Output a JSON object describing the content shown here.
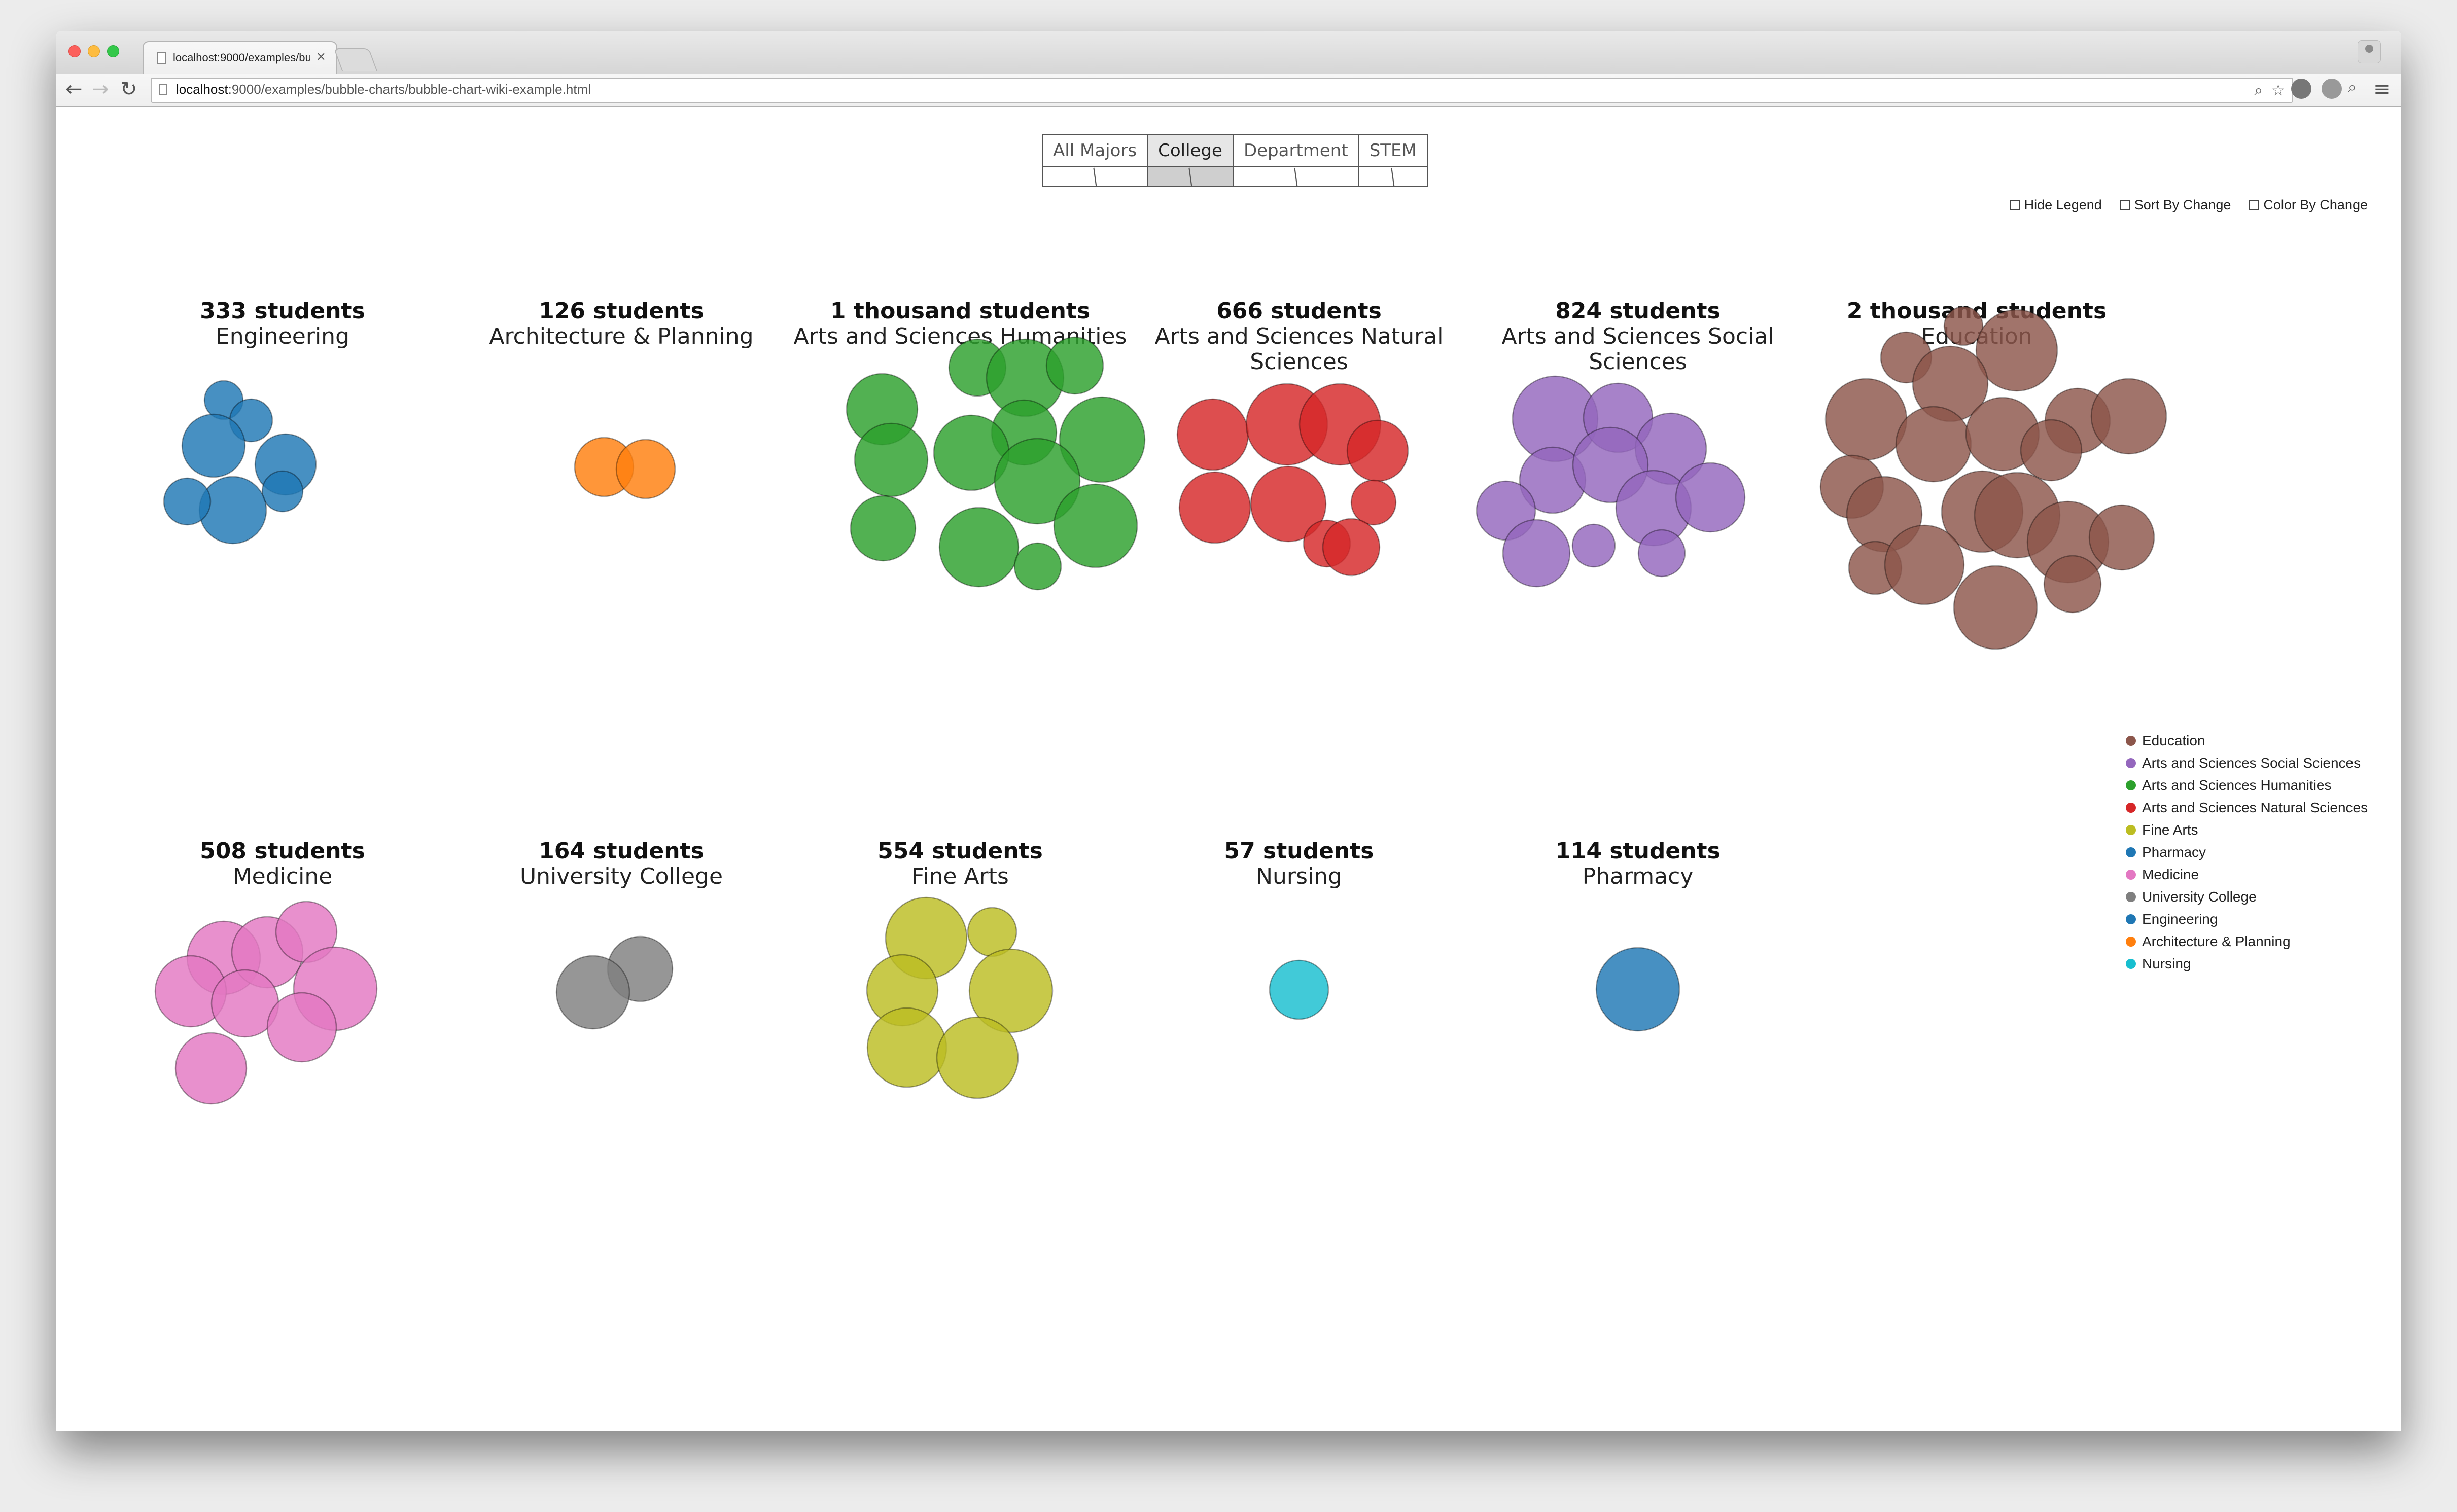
{
  "browser": {
    "tab_title": "localhost:9000/examples/bu",
    "tab_close": "×",
    "url_host": "localhost",
    "url_rest": ":9000/examples/bubble-charts/bubble-chart-wiki-example.html",
    "nav_back": "←",
    "nav_forward": "→",
    "nav_reload": "↻",
    "menu_icon": "≡"
  },
  "modes": [
    {
      "label": "All Majors",
      "active": false
    },
    {
      "label": "College",
      "active": true
    },
    {
      "label": "Department",
      "active": false
    },
    {
      "label": "STEM",
      "active": false
    }
  ],
  "options": [
    {
      "label": "Hide Legend",
      "checked": false
    },
    {
      "label": "Sort By Change",
      "checked": false
    },
    {
      "label": "Color By Change",
      "checked": false
    }
  ],
  "groups": [
    {
      "count": "333 students",
      "name": "Engineering",
      "color": "#1f77b4"
    },
    {
      "count": "126 students",
      "name": "Architecture & Planning",
      "color": "#ff7f0e"
    },
    {
      "count": "1 thousand students",
      "name": "Arts and Sciences Humanities",
      "color": "#2ca02c"
    },
    {
      "count": "666 students",
      "name": "Arts and Sciences Natural Sciences",
      "color": "#d62728"
    },
    {
      "count": "824 students",
      "name": "Arts and Sciences Social Sciences",
      "color": "#9467bd"
    },
    {
      "count": "2 thousand students",
      "name": "Education",
      "color": "#8c564b"
    },
    {
      "count": "508 students",
      "name": "Medicine",
      "color": "#e377c2"
    },
    {
      "count": "164 students",
      "name": "University College",
      "color": "#7f7f7f"
    },
    {
      "count": "554 students",
      "name": "Fine Arts",
      "color": "#bcbd22"
    },
    {
      "count": "57 students",
      "name": "Nursing",
      "color": "#17becf"
    },
    {
      "count": "114 students",
      "name": "Pharmacy",
      "color": "#1f77b4"
    }
  ],
  "legend": [
    {
      "label": "Education",
      "color": "#8c564b"
    },
    {
      "label": "Arts and Sciences Social Sciences",
      "color": "#9467bd"
    },
    {
      "label": "Arts and Sciences Humanities",
      "color": "#2ca02c"
    },
    {
      "label": "Arts and Sciences Natural Sciences",
      "color": "#d62728"
    },
    {
      "label": "Fine Arts",
      "color": "#bcbd22"
    },
    {
      "label": "Pharmacy",
      "color": "#1f77b4"
    },
    {
      "label": "Medicine",
      "color": "#e377c2"
    },
    {
      "label": "University College",
      "color": "#7f7f7f"
    },
    {
      "label": "Engineering",
      "color": "#1f77b4"
    },
    {
      "label": "Architecture & Planning",
      "color": "#ff7f0e"
    },
    {
      "label": "Nursing",
      "color": "#17becf"
    }
  ]
}
